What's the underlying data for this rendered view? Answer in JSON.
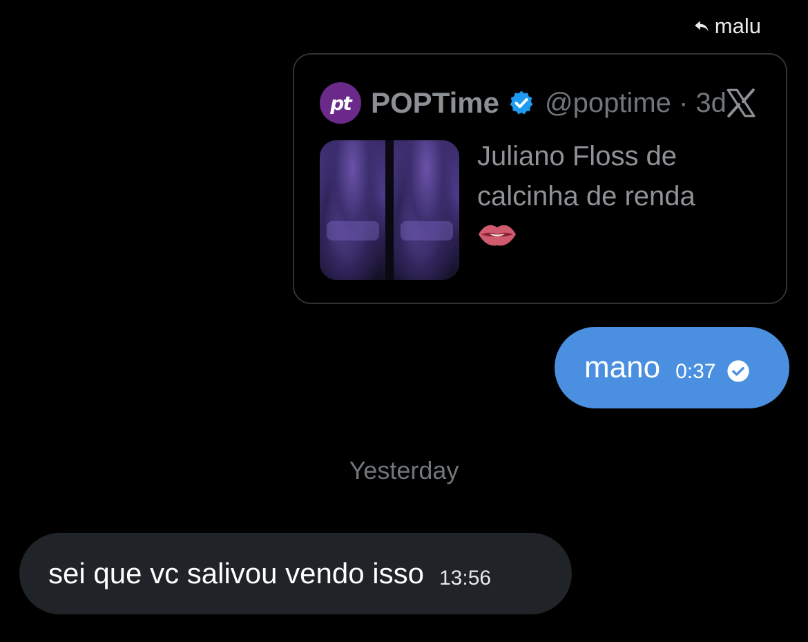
{
  "reply_indicator": {
    "icon": "reply-arrow-icon",
    "name": "malu"
  },
  "tweet": {
    "avatar_text": "pt",
    "avatar_color": "#6b2a8a",
    "author_name": "POPTime",
    "verified": true,
    "handle": "@poptime · 3d",
    "text": "Juliano Floss de calcinha de renda",
    "emoji": "lips-biting-emoji",
    "source_icon": "x-logo-icon",
    "has_thumbnail": true
  },
  "messages": [
    {
      "direction": "sent",
      "text": "mano",
      "time": "0:37",
      "status_icon": "read-check-icon",
      "color": "#4b8fe0"
    },
    {
      "direction": "received",
      "text": "sei que vc salivou vendo isso",
      "time": "13:56",
      "color": "#202327"
    }
  ],
  "date_separator": "Yesterday",
  "colors": {
    "background": "#000000",
    "verified_badge": "#1d9bf0",
    "muted_text": "#71767b"
  }
}
